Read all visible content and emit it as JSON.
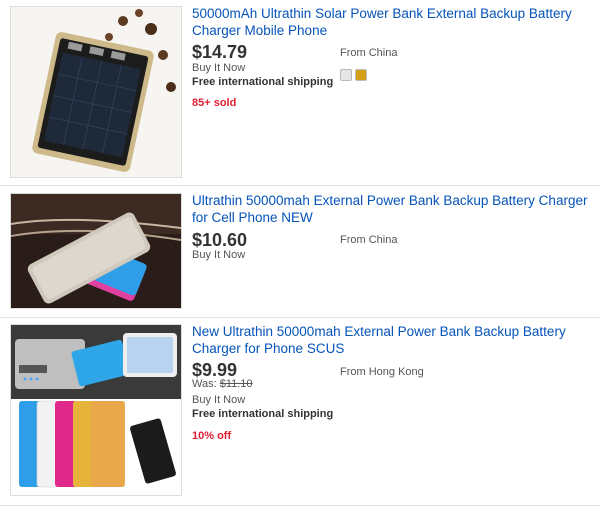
{
  "listings": [
    {
      "title": "50000mAh Ultrathin Solar Power Bank External Backup Battery Charger Mobile Phone",
      "price": "$14.79",
      "format": "Buy It Now",
      "shipping": "Free international shipping",
      "hotness": "85+ sold",
      "location": "From China",
      "color_swatches": [
        "#e6e6e6",
        "#d4a017"
      ],
      "image_icon": "solar-power-bank-photo"
    },
    {
      "title": "Ultrathin 50000mah External Power Bank Backup Battery Charger for Cell Phone NEW",
      "price": "$10.60",
      "format": "Buy It Now",
      "location": "From China",
      "image_icon": "slim-power-bank-photo"
    },
    {
      "title": "New Ultrathin 50000mah External Power Bank Backup Battery Charger for Phone SCUS",
      "price": "$9.99",
      "was_label": "Was: ",
      "was_price": "$11.10",
      "format": "Buy It Now",
      "shipping": "Free international shipping",
      "hotness": "10% off",
      "location": "From Hong Kong",
      "image_icon": "colorful-power-banks-photo"
    }
  ]
}
